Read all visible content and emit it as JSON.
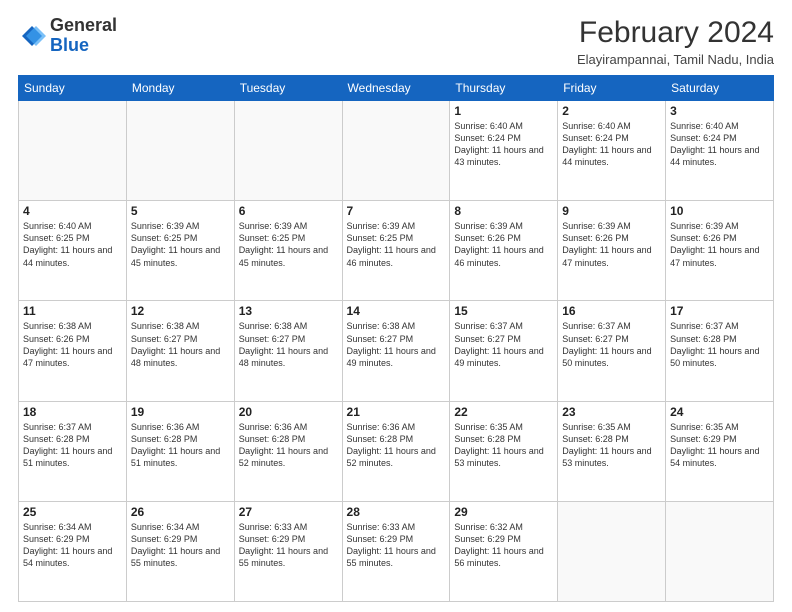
{
  "header": {
    "logo_general": "General",
    "logo_blue": "Blue",
    "month_year": "February 2024",
    "location": "Elayirampannai, Tamil Nadu, India"
  },
  "weekdays": [
    "Sunday",
    "Monday",
    "Tuesday",
    "Wednesday",
    "Thursday",
    "Friday",
    "Saturday"
  ],
  "weeks": [
    [
      {
        "day": "",
        "info": ""
      },
      {
        "day": "",
        "info": ""
      },
      {
        "day": "",
        "info": ""
      },
      {
        "day": "",
        "info": ""
      },
      {
        "day": "1",
        "info": "Sunrise: 6:40 AM\nSunset: 6:24 PM\nDaylight: 11 hours\nand 43 minutes."
      },
      {
        "day": "2",
        "info": "Sunrise: 6:40 AM\nSunset: 6:24 PM\nDaylight: 11 hours\nand 44 minutes."
      },
      {
        "day": "3",
        "info": "Sunrise: 6:40 AM\nSunset: 6:24 PM\nDaylight: 11 hours\nand 44 minutes."
      }
    ],
    [
      {
        "day": "4",
        "info": "Sunrise: 6:40 AM\nSunset: 6:25 PM\nDaylight: 11 hours\nand 44 minutes."
      },
      {
        "day": "5",
        "info": "Sunrise: 6:39 AM\nSunset: 6:25 PM\nDaylight: 11 hours\nand 45 minutes."
      },
      {
        "day": "6",
        "info": "Sunrise: 6:39 AM\nSunset: 6:25 PM\nDaylight: 11 hours\nand 45 minutes."
      },
      {
        "day": "7",
        "info": "Sunrise: 6:39 AM\nSunset: 6:25 PM\nDaylight: 11 hours\nand 46 minutes."
      },
      {
        "day": "8",
        "info": "Sunrise: 6:39 AM\nSunset: 6:26 PM\nDaylight: 11 hours\nand 46 minutes."
      },
      {
        "day": "9",
        "info": "Sunrise: 6:39 AM\nSunset: 6:26 PM\nDaylight: 11 hours\nand 47 minutes."
      },
      {
        "day": "10",
        "info": "Sunrise: 6:39 AM\nSunset: 6:26 PM\nDaylight: 11 hours\nand 47 minutes."
      }
    ],
    [
      {
        "day": "11",
        "info": "Sunrise: 6:38 AM\nSunset: 6:26 PM\nDaylight: 11 hours\nand 47 minutes."
      },
      {
        "day": "12",
        "info": "Sunrise: 6:38 AM\nSunset: 6:27 PM\nDaylight: 11 hours\nand 48 minutes."
      },
      {
        "day": "13",
        "info": "Sunrise: 6:38 AM\nSunset: 6:27 PM\nDaylight: 11 hours\nand 48 minutes."
      },
      {
        "day": "14",
        "info": "Sunrise: 6:38 AM\nSunset: 6:27 PM\nDaylight: 11 hours\nand 49 minutes."
      },
      {
        "day": "15",
        "info": "Sunrise: 6:37 AM\nSunset: 6:27 PM\nDaylight: 11 hours\nand 49 minutes."
      },
      {
        "day": "16",
        "info": "Sunrise: 6:37 AM\nSunset: 6:27 PM\nDaylight: 11 hours\nand 50 minutes."
      },
      {
        "day": "17",
        "info": "Sunrise: 6:37 AM\nSunset: 6:28 PM\nDaylight: 11 hours\nand 50 minutes."
      }
    ],
    [
      {
        "day": "18",
        "info": "Sunrise: 6:37 AM\nSunset: 6:28 PM\nDaylight: 11 hours\nand 51 minutes."
      },
      {
        "day": "19",
        "info": "Sunrise: 6:36 AM\nSunset: 6:28 PM\nDaylight: 11 hours\nand 51 minutes."
      },
      {
        "day": "20",
        "info": "Sunrise: 6:36 AM\nSunset: 6:28 PM\nDaylight: 11 hours\nand 52 minutes."
      },
      {
        "day": "21",
        "info": "Sunrise: 6:36 AM\nSunset: 6:28 PM\nDaylight: 11 hours\nand 52 minutes."
      },
      {
        "day": "22",
        "info": "Sunrise: 6:35 AM\nSunset: 6:28 PM\nDaylight: 11 hours\nand 53 minutes."
      },
      {
        "day": "23",
        "info": "Sunrise: 6:35 AM\nSunset: 6:28 PM\nDaylight: 11 hours\nand 53 minutes."
      },
      {
        "day": "24",
        "info": "Sunrise: 6:35 AM\nSunset: 6:29 PM\nDaylight: 11 hours\nand 54 minutes."
      }
    ],
    [
      {
        "day": "25",
        "info": "Sunrise: 6:34 AM\nSunset: 6:29 PM\nDaylight: 11 hours\nand 54 minutes."
      },
      {
        "day": "26",
        "info": "Sunrise: 6:34 AM\nSunset: 6:29 PM\nDaylight: 11 hours\nand 55 minutes."
      },
      {
        "day": "27",
        "info": "Sunrise: 6:33 AM\nSunset: 6:29 PM\nDaylight: 11 hours\nand 55 minutes."
      },
      {
        "day": "28",
        "info": "Sunrise: 6:33 AM\nSunset: 6:29 PM\nDaylight: 11 hours\nand 55 minutes."
      },
      {
        "day": "29",
        "info": "Sunrise: 6:32 AM\nSunset: 6:29 PM\nDaylight: 11 hours\nand 56 minutes."
      },
      {
        "day": "",
        "info": ""
      },
      {
        "day": "",
        "info": ""
      }
    ]
  ]
}
